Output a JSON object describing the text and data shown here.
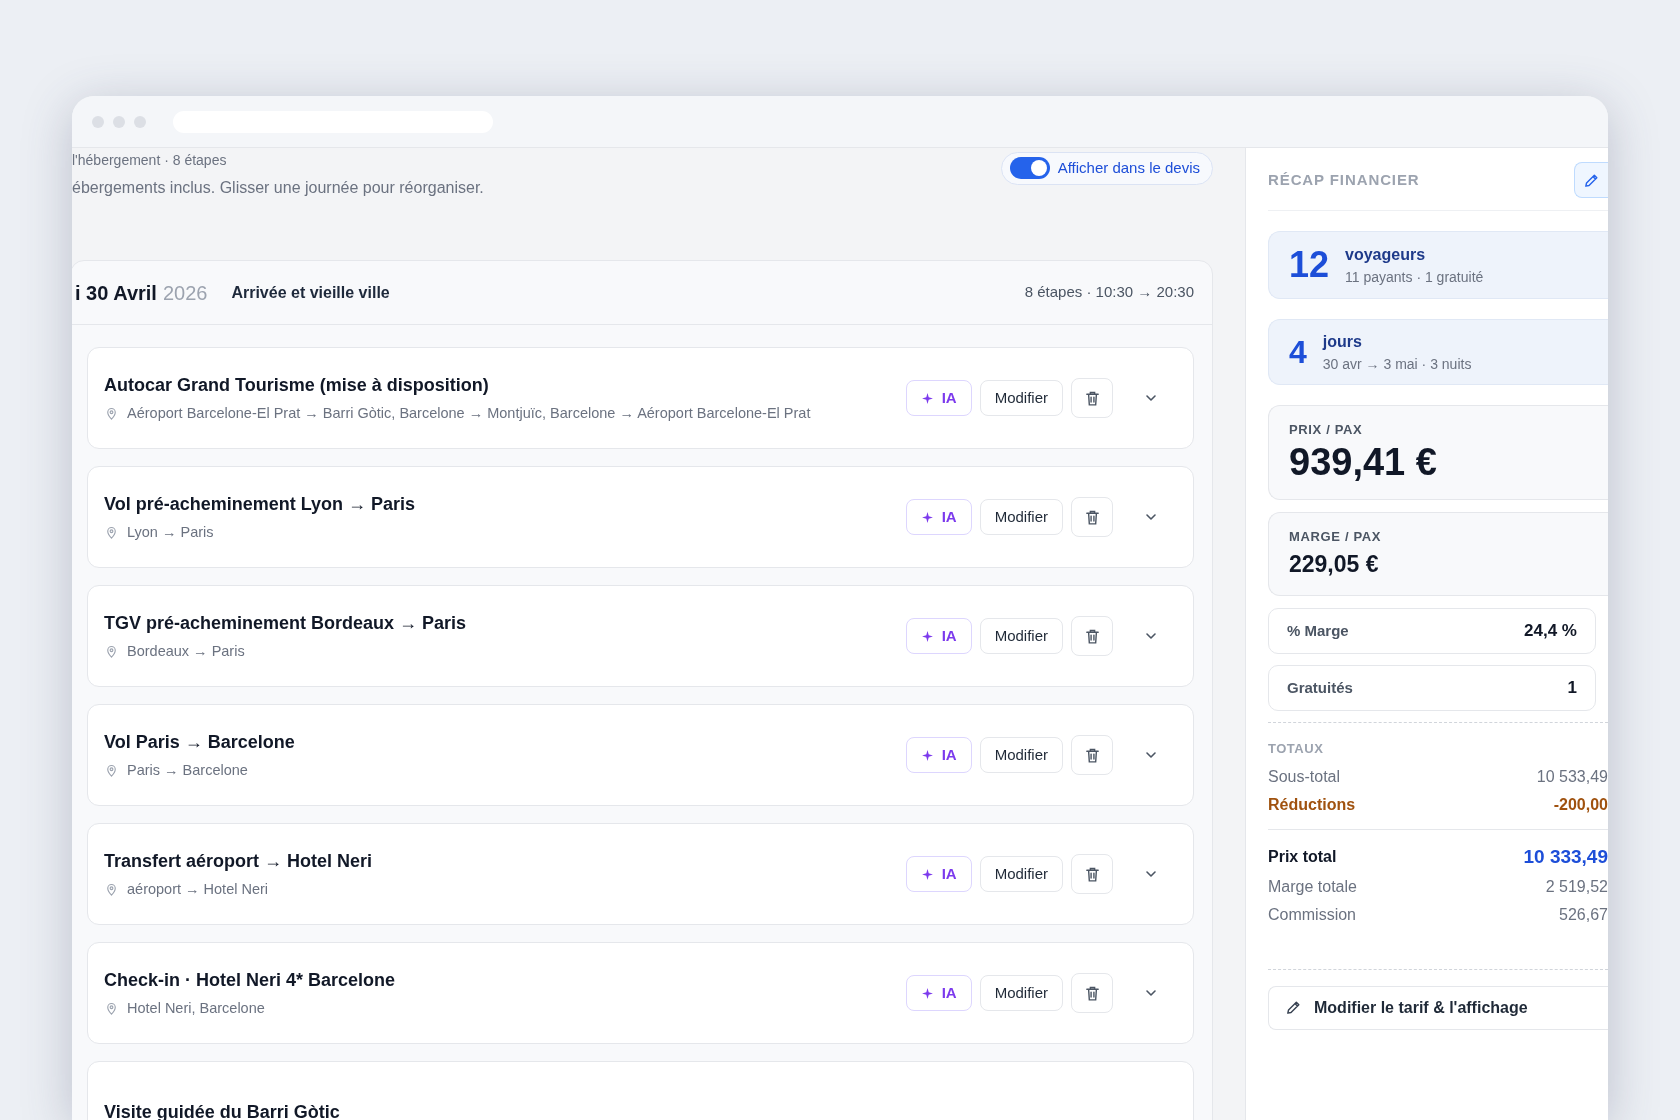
{
  "header": {
    "subtitle": "l'hébergement · 8 étapes",
    "description": "ébergements inclus. Glisser une journée pour réorganiser.",
    "toggle": {
      "label": "Afficher dans le devis",
      "on": true
    }
  },
  "day": {
    "date": "i 30 Avril",
    "year": "2026",
    "title": "Arrivée et vieille ville",
    "summary": "8 étapes · 10:30 → 20:30",
    "items": [
      {
        "title": "Autocar Grand Tourisme (mise à disposition)",
        "location": "Aéroport Barcelone-El Prat → Barri Gòtic, Barcelone → Montjuïc, Barcelone → Aéroport Barcelone-El Prat",
        "ai_label": "IA",
        "edit_label": "Modifier"
      },
      {
        "title": "Vol pré-acheminement Lyon → Paris",
        "location": "Lyon → Paris",
        "ai_label": "IA",
        "edit_label": "Modifier"
      },
      {
        "title": "TGV pré-acheminement Bordeaux → Paris",
        "location": "Bordeaux → Paris",
        "ai_label": "IA",
        "edit_label": "Modifier"
      },
      {
        "title": "Vol Paris → Barcelone",
        "location": "Paris → Barcelone",
        "ai_label": "IA",
        "edit_label": "Modifier"
      },
      {
        "title": "Transfert aéroport → Hotel Neri",
        "location": "aéroport → Hotel Neri",
        "ai_label": "IA",
        "edit_label": "Modifier"
      },
      {
        "title": "Check-in · Hotel Neri 4* Barcelone",
        "location": "Hotel Neri, Barcelone",
        "ai_label": "IA",
        "edit_label": "Modifier"
      },
      {
        "title": "Visite guidée du Barri Gòtic"
      }
    ]
  },
  "recap": {
    "title": "RÉCAP FINANCIER",
    "stats": [
      {
        "value": "12",
        "label": "voyageurs",
        "detail": "11 payants · 1 gratuité",
        "kind": "large"
      },
      {
        "value": "4",
        "label": "jours",
        "detail": "30 avr → 3 mai · 3 nuits",
        "kind": "small"
      }
    ],
    "prices": [
      {
        "label": "PRIX / PAX",
        "value": "939,41 €",
        "kind": "large"
      },
      {
        "label": "MARGE / PAX",
        "value": "229,05 €",
        "kind": "medium"
      }
    ],
    "fields": [
      {
        "label": "% Marge",
        "value": "24,4 %"
      },
      {
        "label": "Gratuités",
        "value": "1"
      }
    ],
    "totals": {
      "title": "TOTAUX",
      "rows": [
        {
          "label": "Sous-total",
          "value": "10 533,49",
          "kind": "normal"
        },
        {
          "label": "Réductions",
          "value": "-200,00",
          "kind": "discount"
        },
        {
          "label": "Prix total",
          "value": "10 333,49",
          "kind": "total"
        },
        {
          "label": "Marge totale",
          "value": "2 519,52",
          "kind": "normal"
        },
        {
          "label": "Commission",
          "value": "526,67",
          "kind": "normal"
        }
      ]
    },
    "action": "Modifier le tarif & l'affichage"
  }
}
